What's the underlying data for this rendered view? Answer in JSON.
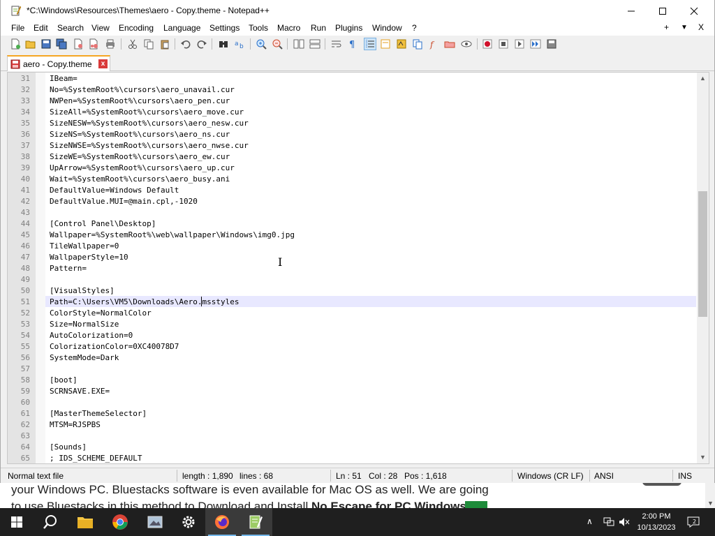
{
  "window": {
    "title": "*C:\\Windows\\Resources\\Themes\\aero - Copy.theme - Notepad++",
    "minimize_icon": "minimize-icon",
    "maximize_icon": "maximize-icon",
    "close_icon": "close-icon"
  },
  "menu": {
    "items": [
      "File",
      "Edit",
      "Search",
      "View",
      "Encoding",
      "Language",
      "Settings",
      "Tools",
      "Macro",
      "Run",
      "Plugins",
      "Window",
      "?"
    ],
    "right": [
      "+",
      "▼",
      "X"
    ]
  },
  "tab": {
    "label": "aero - Copy.theme",
    "close": "x"
  },
  "editor": {
    "current_line": 51,
    "lines": [
      {
        "n": "31",
        "t": "IBeam="
      },
      {
        "n": "32",
        "t": "No=%SystemRoot%\\cursors\\aero_unavail.cur"
      },
      {
        "n": "33",
        "t": "NWPen=%SystemRoot%\\cursors\\aero_pen.cur"
      },
      {
        "n": "34",
        "t": "SizeAll=%SystemRoot%\\cursors\\aero_move.cur"
      },
      {
        "n": "35",
        "t": "SizeNESW=%SystemRoot%\\cursors\\aero_nesw.cur"
      },
      {
        "n": "36",
        "t": "SizeNS=%SystemRoot%\\cursors\\aero_ns.cur"
      },
      {
        "n": "37",
        "t": "SizeNWSE=%SystemRoot%\\cursors\\aero_nwse.cur"
      },
      {
        "n": "38",
        "t": "SizeWE=%SystemRoot%\\cursors\\aero_ew.cur"
      },
      {
        "n": "39",
        "t": "UpArrow=%SystemRoot%\\cursors\\aero_up.cur"
      },
      {
        "n": "40",
        "t": "Wait=%SystemRoot%\\cursors\\aero_busy.ani"
      },
      {
        "n": "41",
        "t": "DefaultValue=Windows Default"
      },
      {
        "n": "42",
        "t": "DefaultValue.MUI=@main.cpl,-1020"
      },
      {
        "n": "43",
        "t": ""
      },
      {
        "n": "44",
        "t": "[Control Panel\\Desktop]"
      },
      {
        "n": "45",
        "t": "Wallpaper=%SystemRoot%\\web\\wallpaper\\Windows\\img0.jpg"
      },
      {
        "n": "46",
        "t": "TileWallpaper=0"
      },
      {
        "n": "47",
        "t": "WallpaperStyle=10"
      },
      {
        "n": "48",
        "t": "Pattern="
      },
      {
        "n": "49",
        "t": ""
      },
      {
        "n": "50",
        "t": "[VisualStyles]"
      },
      {
        "n": "51",
        "t": "Path=C:\\Users\\VM5\\Downloads\\Aero.msstyles"
      },
      {
        "n": "52",
        "t": "ColorStyle=NormalColor"
      },
      {
        "n": "53",
        "t": "Size=NormalSize"
      },
      {
        "n": "54",
        "t": "AutoColorization=0"
      },
      {
        "n": "55",
        "t": "ColorizationColor=0XC40078D7"
      },
      {
        "n": "56",
        "t": "SystemMode=Dark"
      },
      {
        "n": "57",
        "t": ""
      },
      {
        "n": "58",
        "t": "[boot]"
      },
      {
        "n": "59",
        "t": "SCRNSAVE.EXE="
      },
      {
        "n": "60",
        "t": ""
      },
      {
        "n": "61",
        "t": "[MasterThemeSelector]"
      },
      {
        "n": "62",
        "t": "MTSM=RJSPBS"
      },
      {
        "n": "63",
        "t": ""
      },
      {
        "n": "64",
        "t": "[Sounds]"
      },
      {
        "n": "65",
        "t": "; IDS_SCHEME_DEFAULT"
      }
    ]
  },
  "status": {
    "file_type": "Normal text file",
    "length": "length : 1,890",
    "lines": "lines : 68",
    "ln": "Ln : 51",
    "col": "Col : 28",
    "pos": "Pos : 1,618",
    "eol": "Windows (CR LF)",
    "encoding": "ANSI",
    "mode": "INS"
  },
  "background_page": {
    "line1": "your Windows PC. Bluestacks software is even available for Mac OS as well. We are going",
    "line2_prefix": "to use Bluestacks in this method to Download and Install ",
    "line2_bold": "No Escape for PC Windows"
  },
  "taskbar": {
    "time": "2:00 PM",
    "date": "10/13/2023"
  },
  "colors": {
    "current_line_bg": "#e8e8ff",
    "tab_accent": "#f5a623",
    "taskbar_bg": "#1f1f1f"
  }
}
